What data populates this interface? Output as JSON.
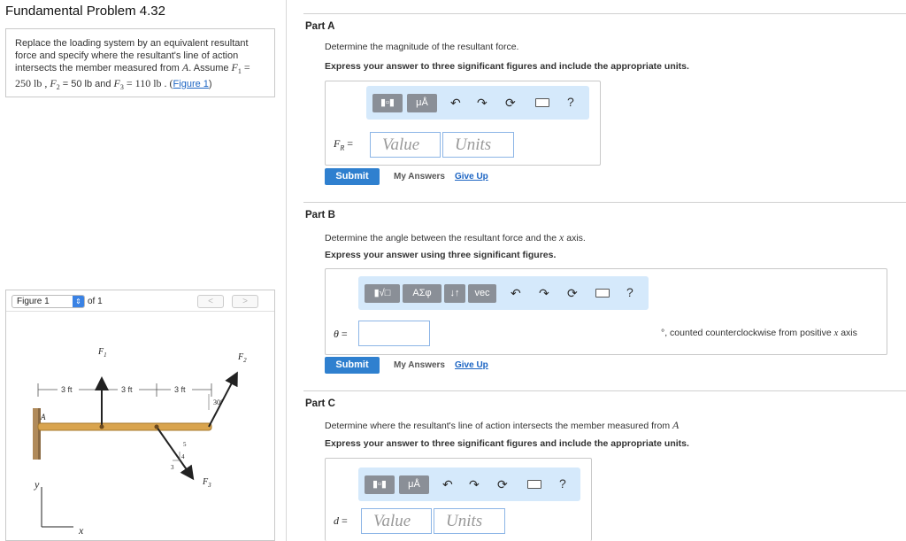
{
  "left": {
    "title": "Fundamental Problem 4.32",
    "problem": {
      "line1": "Replace the loading system by an equivalent resultant",
      "line2": "force and specify where the resultant's line of action",
      "line3a": "intersects the member measured from ",
      "point": "A",
      "line3b": ". Assume ",
      "f1": "F",
      "f1sub": "1",
      "eq": " =",
      "line4a": "250 lb , ",
      "f2": "F",
      "f2sub": "2",
      "line4b": " = 50 lb and ",
      "f3": "F",
      "f3sub": "3",
      "line4c": " = 110 lb . (",
      "figure_link": "Figure 1",
      "line4d": ")"
    },
    "figure_panel": {
      "selector": "Figure 1",
      "of_label": "of 1",
      "prev": "<",
      "next": ">"
    },
    "figure": {
      "dim1": "3 ft",
      "dim2": "3 ft",
      "dim3": "3 ft",
      "angle": "30°",
      "F1": "F",
      "F1sub": "1",
      "F2": "F",
      "F2sub": "2",
      "F3": "F",
      "F3sub": "3",
      "pointA": "A",
      "y": "y",
      "x": "x",
      "slope_4": "4",
      "slope_5": "5",
      "slope_3": "3"
    }
  },
  "parts": {
    "a": {
      "title": "Part A",
      "question": "Determine the magnitude of the resultant force.",
      "instruction": "Express your answer to three significant figures and include the appropriate units.",
      "label": "F",
      "label_sub": "R",
      "label_eq": " =",
      "value_placeholder": "Value",
      "units_placeholder": "Units",
      "submit": "Submit",
      "my_answers": "My Answers",
      "give_up": "Give Up"
    },
    "b": {
      "title": "Part B",
      "question_a": "Determine the angle between the resultant force and the ",
      "question_var": "x",
      "question_b": " axis.",
      "instruction": "Express your answer using three significant figures.",
      "label": "θ",
      "label_eq": " =",
      "suffix_a": "°, counted counterclockwise from positive ",
      "suffix_var": "x",
      "suffix_b": " axis",
      "submit": "Submit",
      "my_answers": "My Answers",
      "give_up": "Give Up"
    },
    "c": {
      "title": "Part C",
      "question_a": "Determine where the resultant's line of action intersects the member measured from ",
      "question_var": "A",
      "instruction": "Express your answer to three significant figures and include the appropriate units.",
      "label": "d",
      "label_eq": " =",
      "value_placeholder": "Value",
      "units_placeholder": "Units"
    }
  },
  "toolbar": {
    "mu_a": "μÅ",
    "greek": "ΑΣφ",
    "sort": "↓↑",
    "vec": "vec",
    "help": "?"
  }
}
